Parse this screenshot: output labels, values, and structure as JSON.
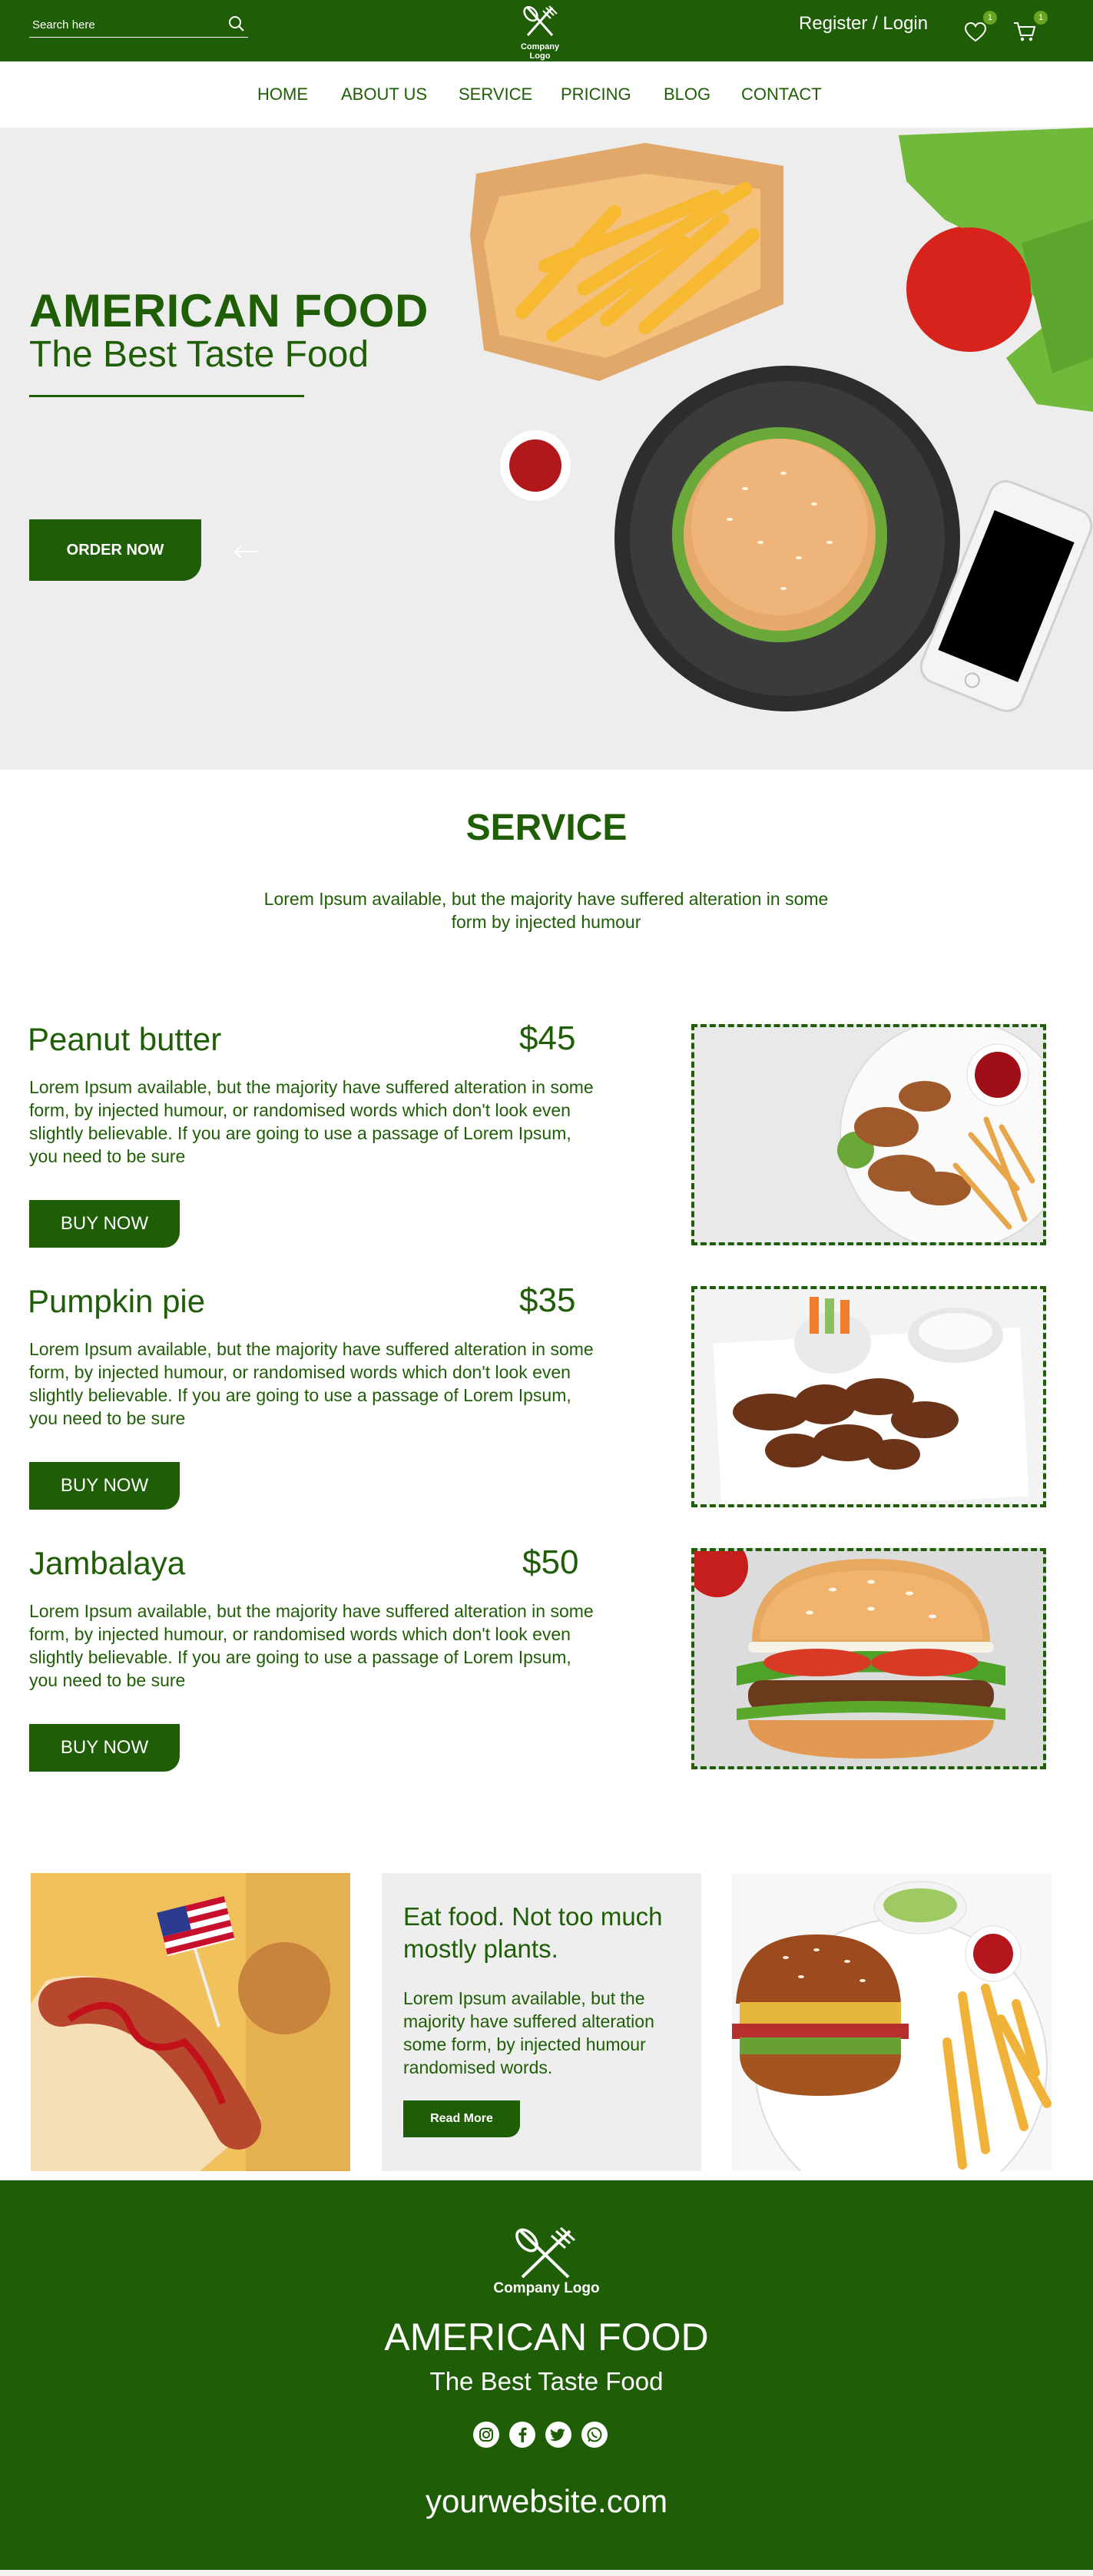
{
  "header": {
    "search_placeholder": "Search here",
    "logo_label": "Company Logo",
    "auth_label": "Register / Login",
    "wishlist_count": "1",
    "cart_count": "1"
  },
  "nav": {
    "items": [
      "HOME",
      "ABOUT US",
      "SERVICE",
      "PRICING",
      "BLOG",
      "CONTACT"
    ]
  },
  "hero": {
    "title": "AMERICAN FOOD",
    "subtitle": "The Best Taste Food",
    "order_button": "ORDER NOW"
  },
  "service": {
    "title": "SERVICE",
    "description": "Lorem Ipsum available, but the majority have suffered alteration in some form by injected humour"
  },
  "items": [
    {
      "name": "Peanut butter",
      "price": "$45",
      "description": "Lorem Ipsum available, but the majority have suffered alteration in some form, by injected humour, or randomised words which don't look even slightly believable. If you are going to use a passage of Lorem Ipsum, you need to be sure",
      "button": "BUY NOW"
    },
    {
      "name": "Pumpkin pie",
      "price": "$35",
      "description": "Lorem Ipsum available, but the majority have suffered alteration in some form, by injected humour, or randomised words which don't look even slightly believable. If you are going to use a passage of Lorem Ipsum, you need to be sure",
      "button": "BUY NOW"
    },
    {
      "name": "Jambalaya",
      "price": "$50",
      "description": "Lorem Ipsum available, but the majority have suffered alteration in some form, by injected humour, or randomised words which don't look even slightly believable. If you are going to use a passage of Lorem Ipsum, you need to be sure",
      "button": "BUY NOW"
    }
  ],
  "promo": {
    "title": "Eat food. Not too much mostly plants.",
    "description": "Lorem Ipsum available, but the majority have suffered alteration some form, by injected humour randomised words.",
    "button": "Read More"
  },
  "footer": {
    "logo_label": "Company Logo",
    "title": "AMERICAN FOOD",
    "subtitle": "The Best Taste Food",
    "social_icons": [
      "instagram-icon",
      "facebook-icon",
      "twitter-icon",
      "whatsapp-icon"
    ],
    "website": "yourwebsite.com"
  },
  "colors": {
    "primary": "#1f5e06",
    "accent": "#6aa321",
    "panel": "#eeeeee"
  }
}
